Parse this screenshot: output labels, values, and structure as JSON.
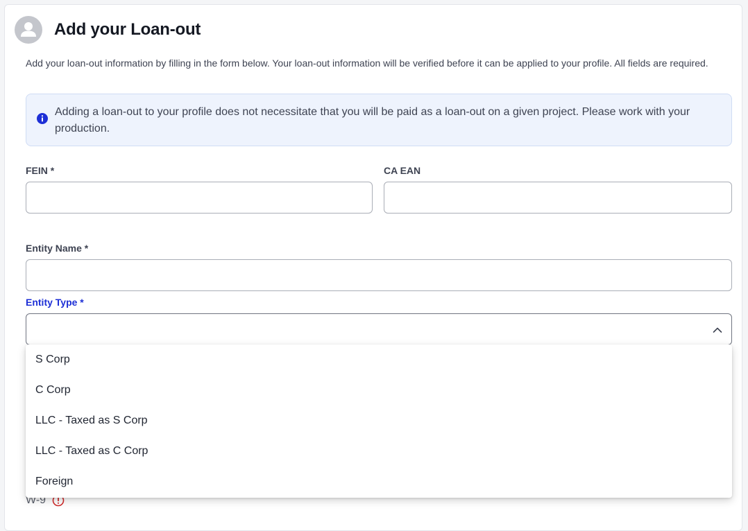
{
  "header": {
    "title": "Add your Loan-out",
    "avatar_icon": "user-avatar-icon"
  },
  "description": "Add your loan-out information by filling in the form below. Your loan-out information will be verified before it can be applied to your profile. All fields are required.",
  "info_banner": {
    "icon": "info-icon",
    "text": "Adding a loan-out to your profile does not necessitate that you will be paid as a loan-out on a given project. Please work with your production."
  },
  "form": {
    "fein_label": "FEIN *",
    "fein_value": "",
    "ca_ean_label": "CA EAN",
    "ca_ean_value": "",
    "entity_name_label": "Entity Name *",
    "entity_name_value": "",
    "entity_type_label": "Entity Type *",
    "entity_type_value": "",
    "entity_type_options": [
      "S Corp",
      "C Corp",
      "LLC - Taxed as S Corp",
      "LLC - Taxed as C Corp",
      "Foreign"
    ],
    "w9_label": "W-9"
  },
  "colors": {
    "active_label": "#1d2fd6",
    "info_icon": "#1d2fd6",
    "warning_icon": "#d12c2c",
    "info_background": "#eef3fd"
  }
}
